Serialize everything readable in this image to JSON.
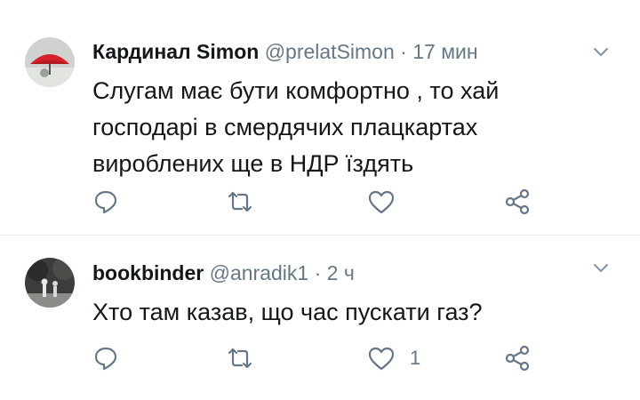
{
  "tweets": [
    {
      "name": "Кардинал Simon",
      "handle": "@prelatSimon",
      "separator": "·",
      "time": "17 мин",
      "text": "Слугам має бути комфортно , то хай господарі в смердячих плацкартах вироблених ще в НДР їздять",
      "like_count": ""
    },
    {
      "name": "bookbinder",
      "handle": "@anradik1",
      "separator": "·",
      "time": "2 ч",
      "text": "Хто там казав, що час пускати газ?",
      "like_count": "1"
    }
  ],
  "icons": {
    "reply": "reply-icon",
    "retweet": "retweet-icon",
    "like": "heart-icon",
    "share": "share-icon",
    "menu": "chevron-down-icon"
  },
  "colors": {
    "icon": "#657786",
    "text": "#14171a",
    "secondary": "#657786",
    "divider": "#e6ecf0"
  }
}
